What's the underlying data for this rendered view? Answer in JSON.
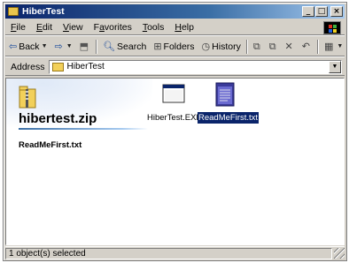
{
  "window": {
    "title": "HiberTest"
  },
  "menu": [
    "File",
    "Edit",
    "View",
    "Favorites",
    "Tools",
    "Help"
  ],
  "menu_underline": [
    "F",
    "E",
    "V",
    "a",
    "T",
    "H"
  ],
  "toolbar": {
    "back_label": "Back",
    "search_label": "Search",
    "folders_label": "Folders",
    "history_label": "History"
  },
  "address": {
    "label": "Address",
    "value": "HiberTest"
  },
  "info_pane": {
    "title": "hibertest.zip",
    "selected_file": "ReadMeFirst.txt"
  },
  "files": [
    {
      "name": "HiberTest.EXE",
      "icon": "exe-window-icon",
      "selected": false
    },
    {
      "name": "ReadMeFirst.txt",
      "icon": "notepad-text-icon",
      "selected": true
    }
  ],
  "status": {
    "text": "1 object(s) selected"
  },
  "colors": {
    "titlebar": "#0a246a",
    "selection": "#0a246a",
    "chrome": "#d4d0c8"
  }
}
